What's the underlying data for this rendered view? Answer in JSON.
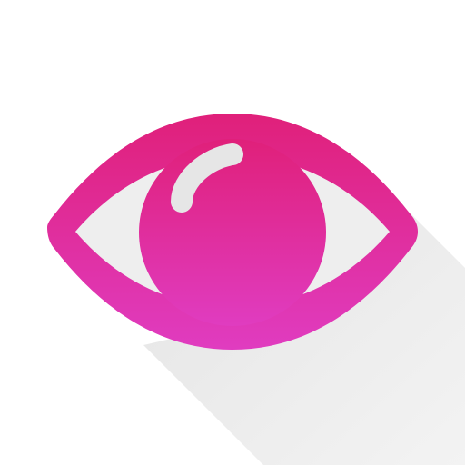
{
  "icon": {
    "name": "eye-icon",
    "colors": {
      "background": "#ffffff",
      "long_shadow": "#e9e9e9",
      "eye_top": "#e0207a",
      "eye_bottom": "#e03cc0",
      "sclera": "#eeeeee",
      "highlight": "#e6e6e6"
    }
  }
}
